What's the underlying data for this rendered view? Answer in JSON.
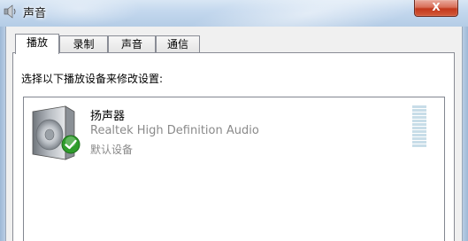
{
  "window": {
    "title": "声音",
    "close_label": "X",
    "title_icon": "speaker-icon"
  },
  "tabs": [
    {
      "label": "播放",
      "active": true
    },
    {
      "label": "录制",
      "active": false
    },
    {
      "label": "声音",
      "active": false
    },
    {
      "label": "通信",
      "active": false
    }
  ],
  "playback": {
    "instruction": "选择以下播放设备来修改设置:",
    "devices": [
      {
        "name": "扬声器",
        "driver": "Realtek High Definition Audio",
        "status": "默认设备",
        "icon": "speaker-icon",
        "badge": "green-check-icon",
        "level": 0
      }
    ]
  },
  "colors": {
    "accent_check": "#2e9c2a",
    "level_meter": "#c8dde8",
    "close_button": "#c2381c"
  }
}
